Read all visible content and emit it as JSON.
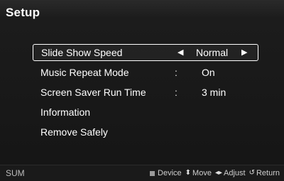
{
  "header": {
    "title": "Setup"
  },
  "menu": {
    "items": [
      {
        "label": "Slide Show Speed",
        "value": "Normal",
        "left_arrow": "◀",
        "right_arrow": "▶"
      },
      {
        "label": "Music Repeat Mode",
        "colon": ":",
        "value": "On"
      },
      {
        "label": "Screen Saver Run Time",
        "colon": ":",
        "value": "3 min"
      },
      {
        "label": "Information"
      },
      {
        "label": "Remove Safely"
      }
    ]
  },
  "footer": {
    "sum_label": "SUM",
    "device_label": "Device",
    "move_label": "Move",
    "adjust_label": "Adjust",
    "return_label": "Return",
    "icons": [
      "device-square-icon",
      "up-down-arrow-icon",
      "left-right-arrow-icon",
      "return-icon"
    ]
  },
  "colors": {
    "background": "#151515",
    "text": "#ffffff",
    "footer": "#1a1a1a"
  }
}
